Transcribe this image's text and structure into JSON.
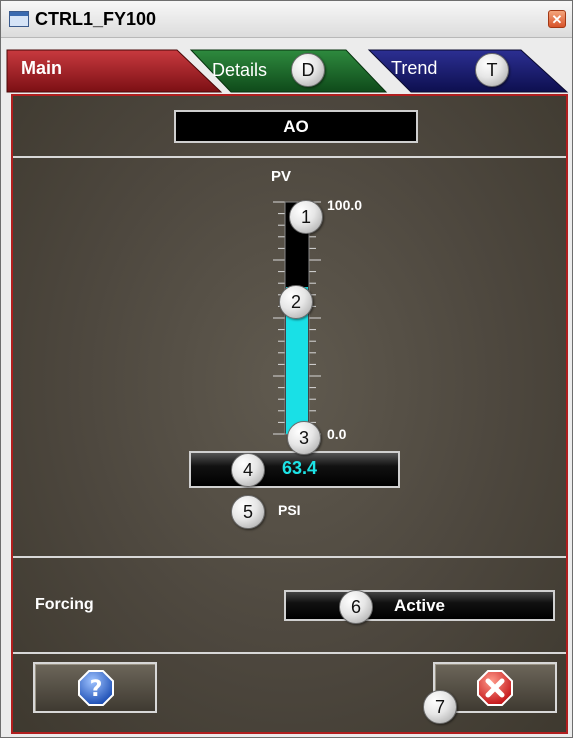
{
  "window": {
    "title": "CTRL1_FY100",
    "close_glyph": "✕"
  },
  "tabs": [
    {
      "label": "Main",
      "active": true,
      "color": "#a11f24"
    },
    {
      "label": "Details",
      "shortcut": "D",
      "active": false,
      "color": "#1c6b2a"
    },
    {
      "label": "Trend",
      "shortcut": "T",
      "active": false,
      "color": "#1b1f78"
    }
  ],
  "main": {
    "block_type": "AO",
    "pv_label": "PV",
    "scale_max": "100.0",
    "scale_min": "0.0",
    "pv_value": "63.4",
    "pv_fraction": 0.634,
    "units": "PSI",
    "forcing_label": "Forcing",
    "forcing_value": "Active"
  },
  "callouts": [
    "1",
    "2",
    "3",
    "4",
    "5",
    "6",
    "7"
  ],
  "buttons": {
    "help": {
      "icon": "help-icon",
      "glyph": "?"
    },
    "close": {
      "icon": "close-icon",
      "glyph": "✕"
    }
  },
  "colors": {
    "bar_fill": "#19e0e6",
    "panel_border": "#b01e1e",
    "value_text": "#1de3e6"
  }
}
